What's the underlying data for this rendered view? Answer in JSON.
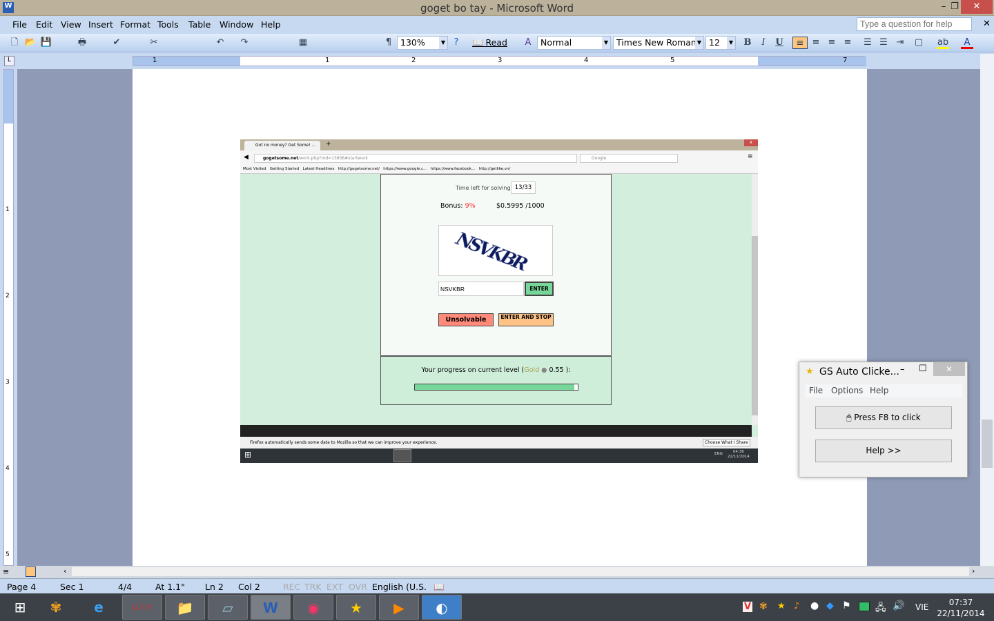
{
  "window": {
    "title": "goget bo tay - Microsoft Word",
    "minimize": "–",
    "restore": "❐",
    "close": "✕"
  },
  "menu": [
    "File",
    "Edit",
    "View",
    "Insert",
    "Format",
    "Tools",
    "Table",
    "Window",
    "Help"
  ],
  "help_placeholder": "Type a question for help",
  "toolbar": {
    "zoom": "130%",
    "read": "Read",
    "style": "Normal",
    "font": "Times New Roman",
    "size": "12",
    "bold": "B",
    "italic": "I",
    "underline": "U"
  },
  "ruler": {
    "h_labels": [
      "1",
      "1",
      "2",
      "3",
      "4",
      "5",
      "7"
    ],
    "v_labels": [
      "1",
      "2",
      "3",
      "4",
      "5"
    ]
  },
  "embedded": {
    "tab_title": "Got no money? Get Some! ...",
    "url_domain": "gogetsome.net",
    "url_path": "/work.php?rnd=13836#startwork",
    "search": "Google",
    "bookmarks": [
      "Most Visited",
      "Getting Started",
      "Latest Headlines",
      "http://gogetsome.net/",
      "https://www.google.c...",
      "https://www.facebook...",
      "http://getlike.vn/"
    ],
    "time_label": "Time left for solving:",
    "time_value": "13/33",
    "bonus_label": "Bonus:",
    "bonus_value": "9%",
    "rate": "$0.5995 /1000",
    "captcha_text": "NSVKBR",
    "input_value": "NSVKBR",
    "enter": "ENTER",
    "unsolvable": "Unsolvable",
    "enter_stop": "ENTER AND STOP",
    "progress_label": "Your progress on current level (",
    "progress_level": "Gold",
    "progress_value": "0.55",
    "progress_end": " ):",
    "progress_fraction": 0.98,
    "notice": "Firefox automatically sends some data to Mozilla so that we can improve your experience.",
    "notice_button": "Choose What I Share",
    "tray_lang": "ENG",
    "tray_time": "04:36",
    "tray_date": "22/11/2014"
  },
  "gs": {
    "title": "GS Auto Clicke...",
    "menu": [
      "File",
      "Options",
      "Help"
    ],
    "click_btn": "Press F8 to click",
    "help_btn": "Help >>"
  },
  "status": {
    "page": "Page 4",
    "sec": "Sec 1",
    "pages": "4/4",
    "at": "At 1.1\"",
    "ln": "Ln 2",
    "col": "Col 2",
    "rec": "REC",
    "trk": "TRK",
    "ext": "EXT",
    "ovr": "OVR",
    "lang": "English (U.S."
  },
  "tray": {
    "lang": "VIE",
    "time": "07:37",
    "date": "22/11/2014"
  },
  "colors": {
    "accent_red": "#ff3333",
    "gold": "#a8a050",
    "enter_green": "#77d699",
    "unsolvable": "#ff8a7a",
    "enter_stop": "#ffc388"
  }
}
